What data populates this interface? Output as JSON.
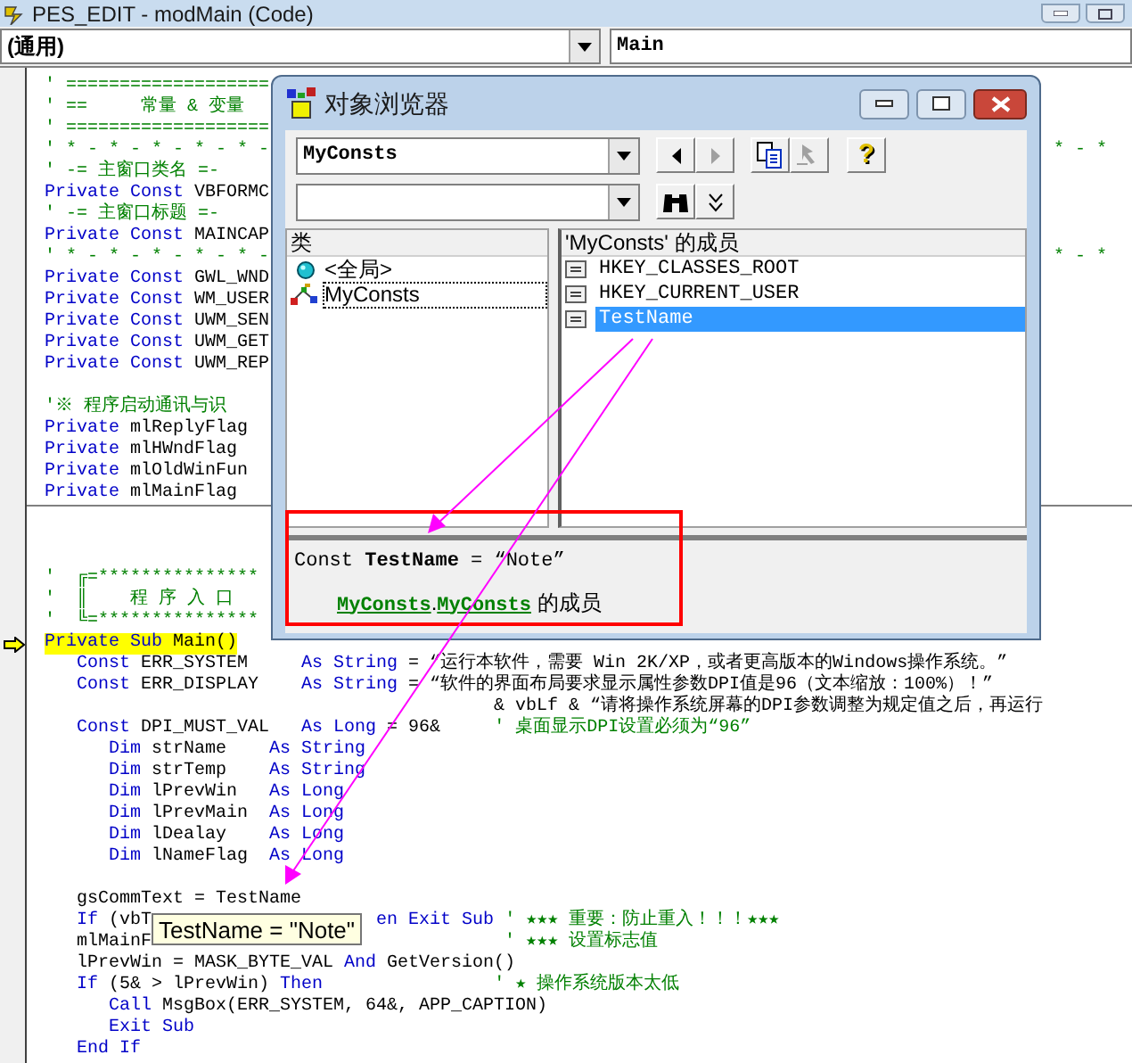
{
  "window": {
    "title": "PES_EDIT - modMain (Code)"
  },
  "object_combo": {
    "value": "(通用)"
  },
  "procedure_combo": {
    "value": "Main"
  },
  "code_lines": [
    {
      "kind": "code",
      "current": false,
      "segments": [
        {
          "kind": "comment",
          "text": "' ==================="
        }
      ]
    },
    {
      "kind": "code",
      "current": false,
      "segments": [
        {
          "kind": "comment",
          "text": "' ==     常量 & 变量"
        }
      ]
    },
    {
      "kind": "code",
      "current": false,
      "segments": [
        {
          "kind": "comment",
          "text": "' ==================="
        }
      ]
    },
    {
      "kind": "code",
      "current": false,
      "segments": [
        {
          "kind": "comment",
          "text": "' * - * - * - * - * -"
        }
      ],
      "right": {
        "kind": "comment",
        "text": "* - *"
      }
    },
    {
      "kind": "code",
      "current": false,
      "segments": [
        {
          "kind": "comment",
          "text": "' -= 主窗口类名 =-"
        }
      ]
    },
    {
      "kind": "code",
      "current": false,
      "segments": [
        {
          "kind": "keyword",
          "text": "Private Const "
        },
        {
          "kind": "plain",
          "text": "VBFORMC"
        }
      ]
    },
    {
      "kind": "code",
      "current": false,
      "segments": [
        {
          "kind": "comment",
          "text": "' -= 主窗口标题 =-"
        }
      ]
    },
    {
      "kind": "code",
      "current": false,
      "segments": [
        {
          "kind": "keyword",
          "text": "Private Const "
        },
        {
          "kind": "plain",
          "text": "MAINCAP"
        }
      ]
    },
    {
      "kind": "code",
      "current": false,
      "segments": [
        {
          "kind": "comment",
          "text": "' * - * - * - * - * -"
        }
      ],
      "right": {
        "kind": "comment",
        "text": "* - *"
      }
    },
    {
      "kind": "code",
      "current": false,
      "segments": [
        {
          "kind": "keyword",
          "text": "Private Const "
        },
        {
          "kind": "plain",
          "text": "GWL_WND"
        }
      ]
    },
    {
      "kind": "code",
      "current": false,
      "segments": [
        {
          "kind": "keyword",
          "text": "Private Const "
        },
        {
          "kind": "plain",
          "text": "WM_USER"
        }
      ]
    },
    {
      "kind": "code",
      "current": false,
      "segments": [
        {
          "kind": "keyword",
          "text": "Private Const "
        },
        {
          "kind": "plain",
          "text": "UWM_SEN"
        }
      ]
    },
    {
      "kind": "code",
      "current": false,
      "segments": [
        {
          "kind": "keyword",
          "text": "Private Const "
        },
        {
          "kind": "plain",
          "text": "UWM_GET"
        }
      ]
    },
    {
      "kind": "code",
      "current": false,
      "segments": [
        {
          "kind": "keyword",
          "text": "Private Const "
        },
        {
          "kind": "plain",
          "text": "UWM_REP"
        }
      ]
    },
    {
      "kind": "blank"
    },
    {
      "kind": "code",
      "current": false,
      "segments": [
        {
          "kind": "comment",
          "text": "'※ 程序启动通讯与识"
        }
      ]
    },
    {
      "kind": "code",
      "current": false,
      "segments": [
        {
          "kind": "keyword",
          "text": "Private "
        },
        {
          "kind": "plain",
          "text": "mlReplyFlag"
        }
      ]
    },
    {
      "kind": "code",
      "current": false,
      "segments": [
        {
          "kind": "keyword",
          "text": "Private "
        },
        {
          "kind": "plain",
          "text": "mlHWndFlag"
        }
      ]
    },
    {
      "kind": "code",
      "current": false,
      "segments": [
        {
          "kind": "keyword",
          "text": "Private "
        },
        {
          "kind": "plain",
          "text": "mlOldWinFun"
        }
      ]
    },
    {
      "kind": "code",
      "current": false,
      "segments": [
        {
          "kind": "keyword",
          "text": "Private "
        },
        {
          "kind": "plain",
          "text": "mlMainFlag"
        }
      ]
    },
    {
      "kind": "separator"
    },
    {
      "kind": "blank"
    },
    {
      "kind": "blank"
    },
    {
      "kind": "code",
      "current": false,
      "segments": [
        {
          "kind": "comment",
          "text": "'  ╔=***************"
        }
      ]
    },
    {
      "kind": "code",
      "current": false,
      "segments": [
        {
          "kind": "comment",
          "text": "'  ║    程 序 入 口"
        }
      ]
    },
    {
      "kind": "code",
      "current": false,
      "segments": [
        {
          "kind": "comment",
          "text": "'  ╚=***************"
        }
      ]
    },
    {
      "kind": "code",
      "current": true,
      "segments": [
        {
          "kind": "keyword",
          "text": "Private Sub "
        },
        {
          "kind": "plain",
          "text": "Main()"
        }
      ]
    },
    {
      "kind": "code",
      "current": false,
      "segments": [
        {
          "kind": "keyword",
          "text": "   Const "
        },
        {
          "kind": "plain",
          "text": "ERR_SYSTEM     "
        },
        {
          "kind": "keyword",
          "text": "As String"
        },
        {
          "kind": "plain",
          "text": " = “运行本软件，需要 Win 2K/XP，或者更高版本的Windows操作系统。”"
        }
      ]
    },
    {
      "kind": "code",
      "current": false,
      "segments": [
        {
          "kind": "keyword",
          "text": "   Const "
        },
        {
          "kind": "plain",
          "text": "ERR_DISPLAY    "
        },
        {
          "kind": "keyword",
          "text": "As String"
        },
        {
          "kind": "plain",
          "text": " = “软件的界面布局要求显示属性参数DPI值是96（文本缩放：100%）！”"
        }
      ]
    },
    {
      "kind": "code",
      "current": false,
      "segments": [
        {
          "kind": "plain",
          "text": "                                          & vbLf & “请将操作系统屏幕的DPI参数调整为规定值之后，再运行"
        }
      ]
    },
    {
      "kind": "code",
      "current": false,
      "segments": [
        {
          "kind": "keyword",
          "text": "   Const "
        },
        {
          "kind": "plain",
          "text": "DPI_MUST_VAL   "
        },
        {
          "kind": "keyword",
          "text": "As Long"
        },
        {
          "kind": "plain",
          "text": " = 96&"
        },
        {
          "kind": "comment",
          "text": "     ' 桌面显示DPI设置必须为“96”"
        }
      ]
    },
    {
      "kind": "code",
      "current": false,
      "segments": [
        {
          "kind": "keyword",
          "text": "      Dim "
        },
        {
          "kind": "plain",
          "text": "strName    "
        },
        {
          "kind": "keyword",
          "text": "As String"
        }
      ]
    },
    {
      "kind": "code",
      "current": false,
      "segments": [
        {
          "kind": "keyword",
          "text": "      Dim "
        },
        {
          "kind": "plain",
          "text": "strTemp    "
        },
        {
          "kind": "keyword",
          "text": "As String"
        }
      ]
    },
    {
      "kind": "code",
      "current": false,
      "segments": [
        {
          "kind": "keyword",
          "text": "      Dim "
        },
        {
          "kind": "plain",
          "text": "lPrevWin   "
        },
        {
          "kind": "keyword",
          "text": "As Long"
        }
      ]
    },
    {
      "kind": "code",
      "current": false,
      "segments": [
        {
          "kind": "keyword",
          "text": "      Dim "
        },
        {
          "kind": "plain",
          "text": "lPrevMain  "
        },
        {
          "kind": "keyword",
          "text": "As Long"
        }
      ]
    },
    {
      "kind": "code",
      "current": false,
      "segments": [
        {
          "kind": "keyword",
          "text": "      Dim "
        },
        {
          "kind": "plain",
          "text": "lDealay    "
        },
        {
          "kind": "keyword",
          "text": "As Long"
        }
      ]
    },
    {
      "kind": "code",
      "current": false,
      "segments": [
        {
          "kind": "keyword",
          "text": "      Dim "
        },
        {
          "kind": "plain",
          "text": "lNameFlag  "
        },
        {
          "kind": "keyword",
          "text": "As Long"
        }
      ]
    },
    {
      "kind": "blank"
    },
    {
      "kind": "code",
      "current": false,
      "segments": [
        {
          "kind": "plain",
          "text": "   gsCommText = TestName"
        }
      ]
    },
    {
      "kind": "code",
      "current": false,
      "segments": [
        {
          "kind": "keyword",
          "text": "   If"
        },
        {
          "kind": "plain",
          "text": " (vbT"
        }
      ],
      "continuation": [
        {
          "kind": "keyword",
          "text": "en Exit Sub"
        },
        {
          "kind": "comment",
          "text": " ' ★★★ 重要：防止重入！！！★★★"
        }
      ]
    },
    {
      "kind": "code",
      "current": false,
      "segments": [
        {
          "kind": "plain",
          "text": "   mlMainF"
        }
      ],
      "continuation": [
        {
          "kind": "comment",
          "text": " ' ★★★ 设置标志值"
        }
      ]
    },
    {
      "kind": "code",
      "current": false,
      "segments": [
        {
          "kind": "plain",
          "text": "   lPrevWin = MASK_BYTE_VAL "
        },
        {
          "kind": "keyword",
          "text": "And"
        },
        {
          "kind": "plain",
          "text": " GetVersion()"
        }
      ]
    },
    {
      "kind": "code",
      "current": false,
      "segments": [
        {
          "kind": "keyword",
          "text": "   If"
        },
        {
          "kind": "plain",
          "text": " (5& > lPrevWin) "
        },
        {
          "kind": "keyword",
          "text": "Then"
        },
        {
          "kind": "comment",
          "text": "                ' ★ 操作系统版本太低"
        }
      ]
    },
    {
      "kind": "code",
      "current": false,
      "segments": [
        {
          "kind": "keyword",
          "text": "      Call"
        },
        {
          "kind": "plain",
          "text": " MsgBox(ERR_SYSTEM, 64&, APP_CAPTION)"
        }
      ]
    },
    {
      "kind": "code",
      "current": false,
      "segments": [
        {
          "kind": "keyword",
          "text": "      Exit Sub"
        }
      ]
    },
    {
      "kind": "code",
      "current": false,
      "segments": [
        {
          "kind": "keyword",
          "text": "   End If"
        }
      ]
    }
  ],
  "tooltip": {
    "text": "TestName = \"Note\""
  },
  "object_browser": {
    "title": "对象浏览器",
    "library_combo": {
      "value": "MyConsts"
    },
    "help_button": "?",
    "classes_header": "类",
    "classes": [
      {
        "name": "<全局>",
        "kind": "globals",
        "selected": false
      },
      {
        "name": "MyConsts",
        "kind": "module",
        "selected": true
      }
    ],
    "members_header": "'MyConsts' 的成员",
    "members": [
      {
        "name": "HKEY_CLASSES_ROOT",
        "selected": false
      },
      {
        "name": "HKEY_CURRENT_USER",
        "selected": false
      },
      {
        "name": "TestName",
        "selected": true
      }
    ],
    "details": {
      "declaration": "Const **TestName** = “Note”",
      "member_of": [
        {
          "kind": "link",
          "text": "MyConsts"
        },
        {
          "kind": "text",
          "text": "."
        },
        {
          "kind": "link",
          "text": "MyConsts"
        },
        {
          "kind": "text",
          "text": " 的成员"
        }
      ]
    }
  }
}
